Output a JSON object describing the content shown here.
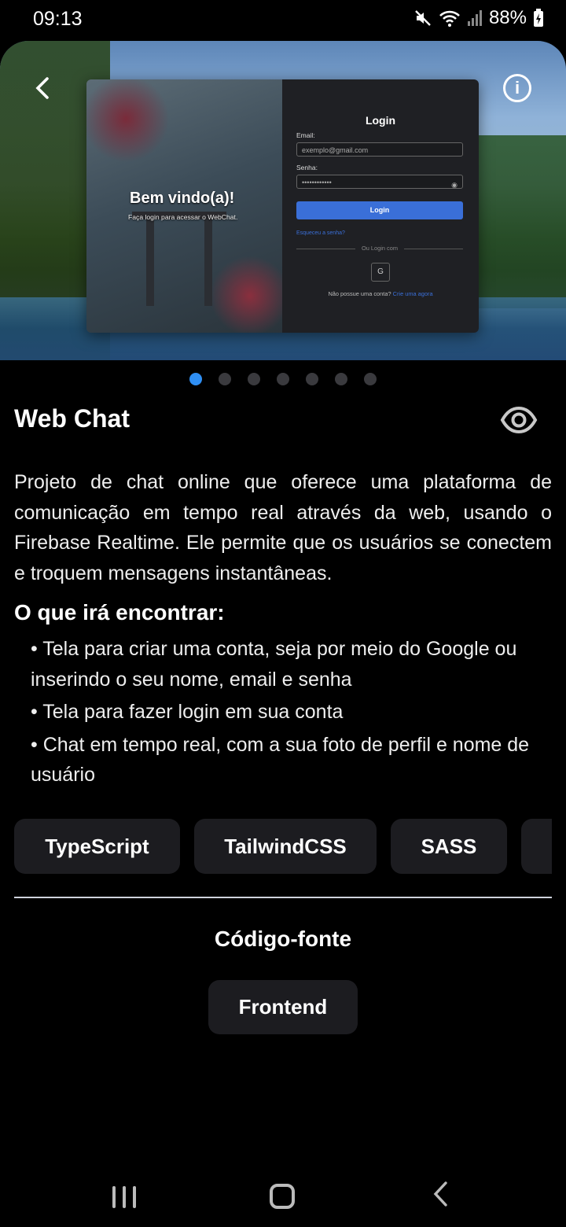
{
  "status_bar": {
    "time": "09:13",
    "battery": "88%"
  },
  "hero": {
    "preview": {
      "welcome": "Bem vindo(a)!",
      "welcome_sub": "Faça login para acessar o WebChat.",
      "login_title": "Login",
      "email_label": "Email:",
      "email_value": "exemplo@gmail.com",
      "password_label": "Senha:",
      "password_value": "••••••••••••",
      "login_button": "Login",
      "forgot": "Esqueceu a senha?",
      "or_login": "Ou Login com",
      "google": "G",
      "no_account": "Não possue uma conta?",
      "create_link": "Crie uma agora"
    }
  },
  "carousel": {
    "count": 7,
    "active": 0
  },
  "project": {
    "title": "Web Chat",
    "description": "Projeto de chat online que oferece uma plataforma de comunicação em tempo real através da web, usando o Firebase Realtime. Ele permite que os usuários se conectem e troquem mensagens instantâneas.",
    "features_title": "O que irá encontrar:",
    "features": [
      "• Tela para criar uma conta, seja por meio do Google ou inserindo o seu nome, email e senha",
      "• Tela para fazer login em sua conta",
      "• Chat em tempo real, com a sua foto de perfil e nome de usuário"
    ],
    "tech": [
      "TypeScript",
      "TailwindCSS",
      "SASS",
      ""
    ]
  },
  "source": {
    "title": "Código-fonte",
    "button": "Frontend"
  },
  "colors": {
    "accent": "#2f8ff4",
    "chip_bg": "#1c1c20"
  }
}
